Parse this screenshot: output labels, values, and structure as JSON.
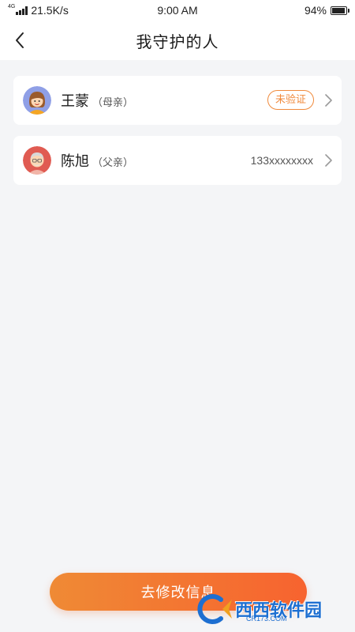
{
  "status_bar": {
    "network": "4G",
    "speed": "21.5K/s",
    "time": "9:00 AM",
    "battery": "94%",
    "battery_level": 0.94
  },
  "header": {
    "title": "我守护的人",
    "back_icon": "chevron-left-icon"
  },
  "people": [
    {
      "name": "王蒙",
      "relation": "（母亲）",
      "status": "未验证",
      "avatar_icon": "female-avatar-icon"
    },
    {
      "name": "陈旭",
      "relation": "（父亲）",
      "phone": "133xxxxxxxx",
      "avatar_icon": "elderly-male-avatar-icon"
    }
  ],
  "actions": {
    "edit_info": "去修改信息"
  },
  "watermark": {
    "text": "西西软件园",
    "sub": "CR173.COM"
  },
  "colors": {
    "accent": "#f08a3c",
    "button_start": "#ef8a35",
    "button_end": "#f7632f",
    "background": "#f4f5f7"
  }
}
